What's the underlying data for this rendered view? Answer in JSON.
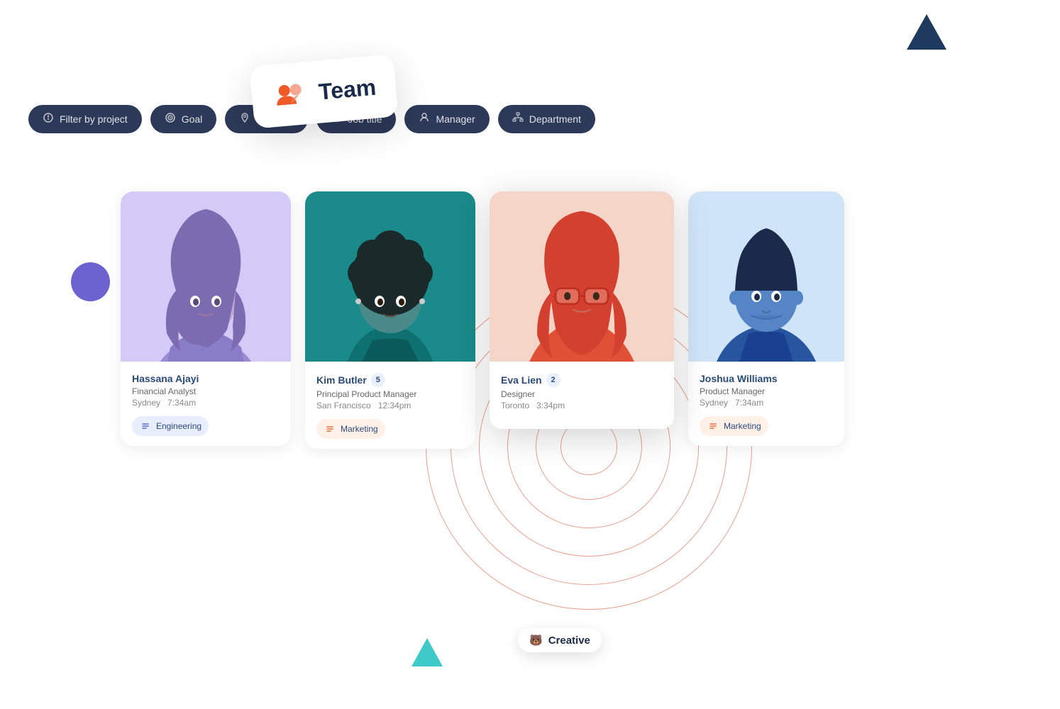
{
  "decorative": {
    "triangle_top_right": "top-right triangle",
    "triangle_bottom": "bottom triangle",
    "circle": "purple circle"
  },
  "filter_bar": {
    "pills": [
      {
        "id": "filter-project",
        "icon": "💡",
        "label": "Filter by project"
      },
      {
        "id": "filter-goal",
        "icon": "🎯",
        "label": "Goal"
      },
      {
        "id": "filter-location",
        "icon": "📍",
        "label": "Location"
      },
      {
        "id": "filter-job-title",
        "icon": "💼",
        "label": "Job title"
      },
      {
        "id": "filter-manager",
        "icon": "👤",
        "label": "Manager"
      },
      {
        "id": "filter-department",
        "icon": "🏢",
        "label": "Department"
      }
    ]
  },
  "team_card": {
    "label": "Team",
    "icon": "team"
  },
  "people": [
    {
      "id": "hassana",
      "name": "Hassana Ajayi",
      "role": "Financial Analyst",
      "location": "Sydney",
      "time": "7:34am",
      "tag": "Engineering",
      "avatar_style": "hassana",
      "badge": null,
      "highlighted": false
    },
    {
      "id": "kim",
      "name": "Kim Butler",
      "role": "Principal Product Manager",
      "location": "San Francisco",
      "time": "12:34pm",
      "tag": "Marketing",
      "avatar_style": "kim",
      "badge": "5",
      "highlighted": false
    },
    {
      "id": "eva",
      "name": "Eva Lien",
      "role": "Designer",
      "location": "Toronto",
      "time": "3:34pm",
      "tag": "Creative",
      "avatar_style": "eva",
      "badge": "2",
      "highlighted": true
    },
    {
      "id": "joshua",
      "name": "Joshua Williams",
      "role": "Product Manager",
      "location": "Sydney",
      "time": "7:34am",
      "tag": "Marketing",
      "avatar_style": "joshua",
      "badge": null,
      "highlighted": false,
      "partial": true
    }
  ],
  "creative_tag": {
    "emoji": "🐻",
    "label": "Creative"
  }
}
